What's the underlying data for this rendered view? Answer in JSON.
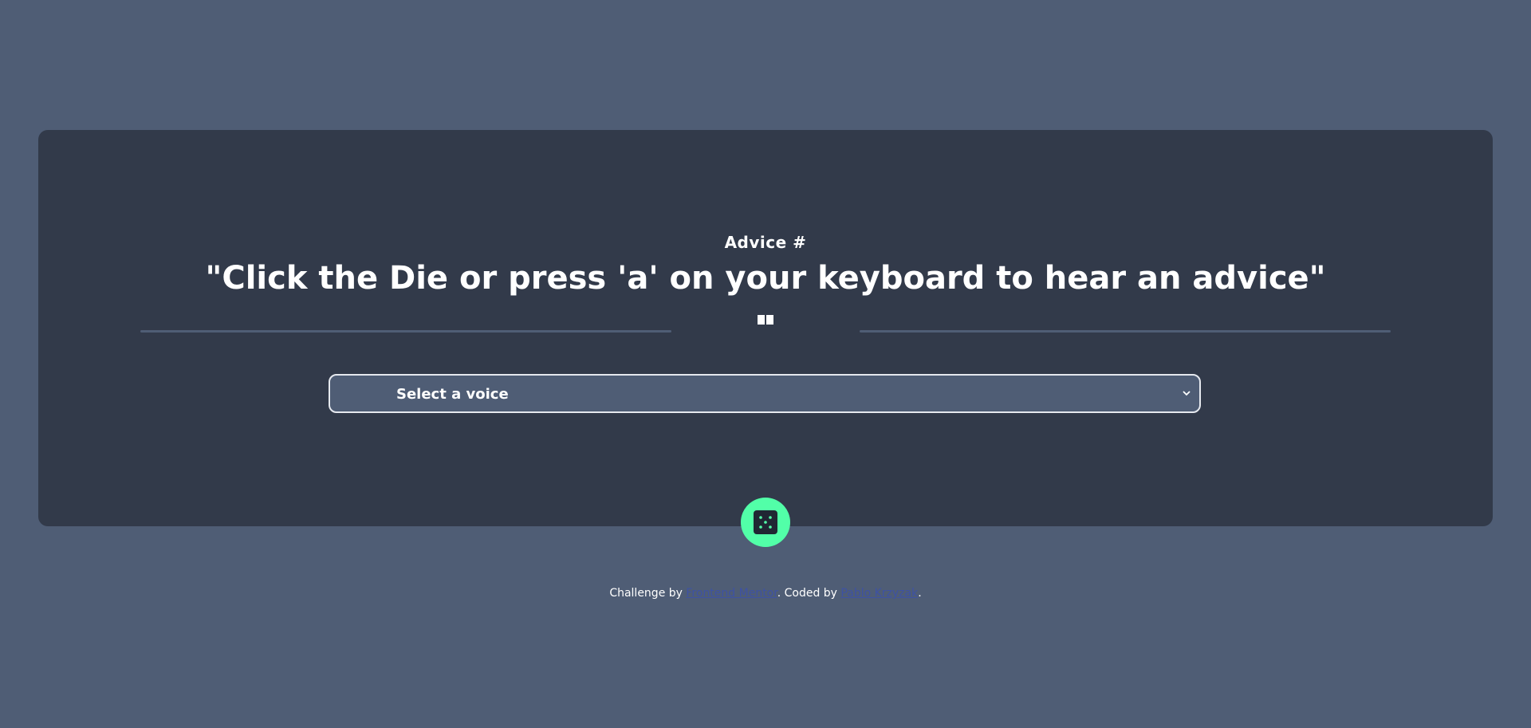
{
  "advice": {
    "label": "Advice #",
    "text": "\"Click the Die or press 'a' on your keyboard to hear an advice\""
  },
  "voice_select": {
    "selected": "Select a voice"
  },
  "icons": {
    "pause": "pause-icon",
    "chevron": "chevron-down-icon",
    "die": "dice-icon"
  },
  "footer": {
    "challenge_prefix": "Challenge by",
    "challenge_link": "Frontend Mentor",
    "coded_prefix": ". Coded by",
    "coded_link": "Pablo Krzyzak",
    "suffix": "."
  },
  "colors": {
    "background": "#4f5d75",
    "card": "#323a4a",
    "accent": "#52ffa8",
    "link": "#3e52a3"
  }
}
